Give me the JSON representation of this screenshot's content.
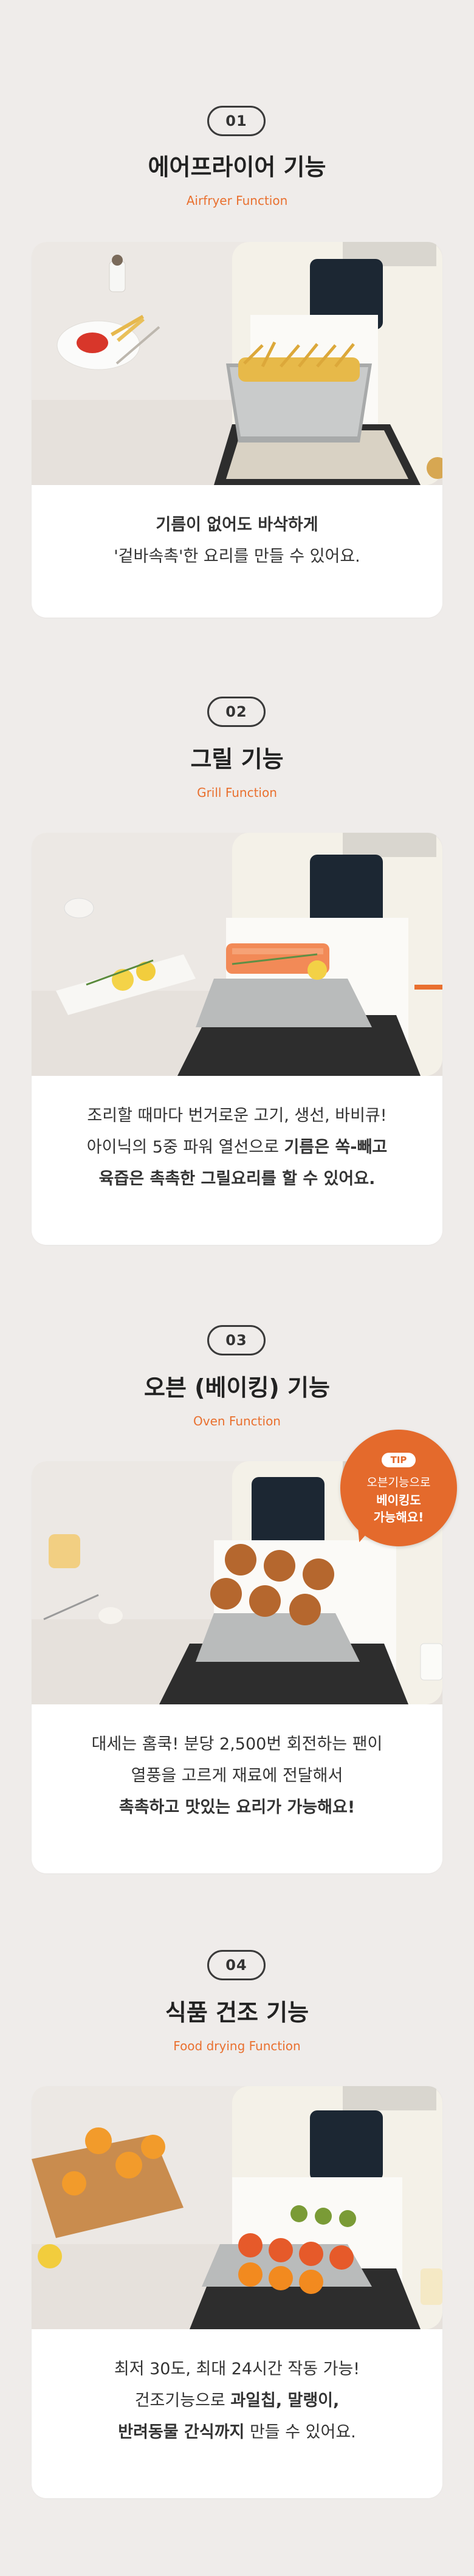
{
  "sections": [
    {
      "number": "01",
      "title": "에어프라이어 기능",
      "subtitle": "Airfryer Function",
      "lines": [
        {
          "segments": [
            {
              "text": "기름이 없어도 바삭하게",
              "bold": true
            }
          ]
        },
        {
          "segments": [
            {
              "text": "'겉바속촉'한 요리를 만들 수 있어요.",
              "bold": false
            }
          ]
        }
      ]
    },
    {
      "number": "02",
      "title": "그릴 기능",
      "subtitle": "Grill Function",
      "lines": [
        {
          "segments": [
            {
              "text": "조리할 때마다 번거로운 고기, 생선, 바비큐!",
              "bold": false
            }
          ]
        },
        {
          "segments": [
            {
              "text": "아이닉의 5중 파워 열선으로 ",
              "bold": false
            },
            {
              "text": "기름은 쏙-빼고",
              "bold": true
            }
          ]
        },
        {
          "segments": [
            {
              "text": "육즙은 촉촉한 그릴요리를 할 수 있어요.",
              "bold": true
            }
          ]
        }
      ]
    },
    {
      "number": "03",
      "title": "오븐 (베이킹) 기능",
      "subtitle": "Oven Function",
      "lines": [
        {
          "segments": [
            {
              "text": "대세는 홈쿡! 분당 2,500번 회전하는 팬이",
              "bold": false
            }
          ]
        },
        {
          "segments": [
            {
              "text": "열풍을 고르게 재료에 전달해서",
              "bold": false
            }
          ]
        },
        {
          "segments": [
            {
              "text": "촉촉하고 맛있는 요리가 가능해요!",
              "bold": true
            }
          ]
        }
      ]
    },
    {
      "number": "04",
      "title": "식품 건조 기능",
      "subtitle": "Food drying Function",
      "lines": [
        {
          "segments": [
            {
              "text": "최저 30도, 최대 24시간 작동 가능!",
              "bold": false
            }
          ]
        },
        {
          "segments": [
            {
              "text": "건조기능으로 ",
              "bold": false
            },
            {
              "text": "과일칩, 말랭이,",
              "bold": true
            }
          ]
        },
        {
          "segments": [
            {
              "text": "반려동물 간식까지",
              "bold": true
            },
            {
              "text": " 만들 수 있어요.",
              "bold": false
            }
          ]
        }
      ]
    }
  ],
  "tip": {
    "label": "TIP",
    "line1": "오븐기능으로",
    "line2": "베이킹도",
    "line3": "가능해요!"
  },
  "colors": {
    "background": "#efecea",
    "accent": "#e9702f",
    "tip_bubble": "#e46a2c",
    "appliance": "#f4f1e8"
  },
  "icons": [
    "airfryer-fries-photo",
    "airfryer-salmon-photo",
    "airfryer-cookies-photo",
    "airfryer-dried-fruit-photo"
  ]
}
